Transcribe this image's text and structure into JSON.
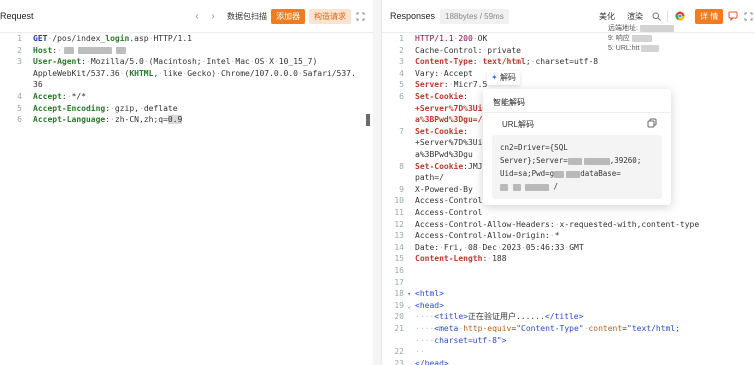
{
  "request": {
    "title": "Request",
    "nav_prev": "‹",
    "nav_next": "›",
    "btn_scan": "数据包扫描",
    "btn_add": "添加器",
    "btn_build": "构造请求",
    "lines": [
      {
        "n": "1",
        "parts": [
          [
            "kw",
            "GET"
          ],
          [
            "dots",
            "·"
          ],
          [
            "val",
            "/pos/index_"
          ],
          [
            "key",
            "login"
          ],
          [
            "val",
            ".asp"
          ],
          [
            "dots",
            "·"
          ],
          [
            "val",
            "HTTP/1.1"
          ]
        ]
      },
      {
        "n": "2",
        "parts": [
          [
            "key",
            "Host"
          ],
          [
            "val",
            ":"
          ],
          [
            "dots",
            "·"
          ]
        ]
      },
      {
        "n": "3",
        "parts": [
          [
            "key",
            "User-Agent"
          ],
          [
            "val",
            ":"
          ],
          [
            "dots",
            "·"
          ],
          [
            "val",
            "Mozilla/5.0"
          ],
          [
            "dots",
            "·"
          ],
          [
            "val",
            "(Macintosh;"
          ],
          [
            "dots",
            "·"
          ],
          [
            "val",
            "Intel"
          ],
          [
            "dots",
            "·"
          ],
          [
            "val",
            "Mac"
          ],
          [
            "dots",
            "·"
          ],
          [
            "val",
            "OS"
          ],
          [
            "dots",
            "·"
          ],
          [
            "val",
            "X"
          ],
          [
            "dots",
            "·"
          ],
          [
            "val",
            "10_15_7)"
          ]
        ]
      },
      {
        "n": "",
        "parts": [
          [
            "val",
            "AppleWebKit/537.36"
          ],
          [
            "dots",
            "·"
          ],
          [
            "val",
            "("
          ],
          [
            "key",
            "KHTML"
          ],
          [
            "val",
            ","
          ],
          [
            "dots",
            "·"
          ],
          [
            "val",
            "like"
          ],
          [
            "dots",
            "·"
          ],
          [
            "val",
            "Gecko)"
          ],
          [
            "dots",
            "·"
          ],
          [
            "val",
            "Chrome/107.0.0.0"
          ],
          [
            "dots",
            "·"
          ],
          [
            "val",
            "Safari/537."
          ]
        ]
      },
      {
        "n": "",
        "parts": [
          [
            "val",
            "36"
          ]
        ]
      },
      {
        "n": "4",
        "parts": [
          [
            "key",
            "Accept"
          ],
          [
            "val",
            ":"
          ],
          [
            "dots",
            "·"
          ],
          [
            "val",
            "*/*"
          ]
        ]
      },
      {
        "n": "5",
        "parts": [
          [
            "key",
            "Accept-Encoding"
          ],
          [
            "val",
            ":"
          ],
          [
            "dots",
            "·"
          ],
          [
            "val",
            "gzip,"
          ],
          [
            "dots",
            "·"
          ],
          [
            "val",
            "deflate"
          ]
        ]
      },
      {
        "n": "6",
        "parts": [
          [
            "key",
            "Accept-Language"
          ],
          [
            "val",
            ":"
          ],
          [
            "dots",
            "·"
          ],
          [
            "val",
            "zh-CN,zh;q="
          ],
          [
            "hl",
            "0.9"
          ]
        ]
      }
    ]
  },
  "response": {
    "title": "Responses",
    "size": "188bytes / 59ms",
    "btn_beautify": "美化",
    "btn_render": "渲染",
    "btn_detail": "详 情",
    "decode_label": "解码",
    "popup_title": "智能解码",
    "popup_sub": "URL解码",
    "popup_text_1": "cn2=Driver={SQL",
    "popup_text_2": "Server};Server=",
    "popup_text_2b": ",39260;",
    "popup_text_3": "Uid=sa;Pwd=g",
    "popup_text_3b": "dataBase=",
    "popup_text_4": "/",
    "right_info_1": "远端地址:",
    "right_info_2": "9: 响应",
    "right_info_3": "5: URL:htt",
    "lines": [
      {
        "n": "1",
        "parts": [
          [
            "str",
            "HTTP/1.1"
          ],
          [
            "dots",
            "·"
          ],
          [
            "str",
            "200"
          ],
          [
            "dots",
            "·"
          ],
          [
            "val",
            "OK"
          ]
        ]
      },
      {
        "n": "2",
        "parts": [
          [
            "val",
            "Cache-Control:"
          ],
          [
            "dots",
            "·"
          ],
          [
            "val",
            "private"
          ]
        ]
      },
      {
        "n": "3",
        "parts": [
          [
            "red-key",
            "Content-Type"
          ],
          [
            "val",
            ":"
          ],
          [
            "dots",
            "·"
          ],
          [
            "red-key",
            "text/html"
          ],
          [
            "val",
            ";"
          ],
          [
            "dots",
            "·"
          ],
          [
            "val",
            "charset=utf-8"
          ]
        ]
      },
      {
        "n": "4",
        "parts": [
          [
            "val",
            "Vary:"
          ],
          [
            "dots",
            "·"
          ],
          [
            "val",
            "Accept"
          ]
        ]
      },
      {
        "n": "5",
        "parts": [
          [
            "red-key",
            "Server"
          ],
          [
            "val",
            ":"
          ],
          [
            "dots",
            "·"
          ],
          [
            "val",
            "Micr"
          ],
          [
            "val",
            "7.5"
          ]
        ]
      },
      {
        "n": "6",
        "parts": [
          [
            "red-key",
            "Set-Cookie"
          ],
          [
            "val",
            ":"
          ]
        ]
      },
      {
        "n": "",
        "parts": [
          [
            "red-key",
            "+Server%7D%3"
          ],
          [
            "red-key",
            "Uid%3Ds"
          ]
        ]
      },
      {
        "n": "",
        "parts": [
          [
            "red-key",
            "a%3BPwd%3Dgu"
          ],
          [
            "red-key",
            "=/"
          ]
        ]
      },
      {
        "n": "7",
        "parts": [
          [
            "red-key",
            "Set-Cookie"
          ],
          [
            "val",
            ":"
          ]
        ]
      },
      {
        "n": "",
        "parts": [
          [
            "val",
            "+Server%7D%3"
          ],
          [
            "val",
            "Uid%3Ds"
          ]
        ]
      },
      {
        "n": "",
        "parts": [
          [
            "val",
            "a%3BPwd%3Dgu"
          ]
        ]
      },
      {
        "n": "8",
        "parts": [
          [
            "red-key",
            "Set-Cookie"
          ],
          [
            "val",
            ":"
          ],
          [
            "val",
            "JMJCL;"
          ]
        ]
      },
      {
        "n": "",
        "parts": [
          [
            "val",
            "path=/"
          ]
        ]
      },
      {
        "n": "9",
        "parts": [
          [
            "val",
            "X-Powered-By"
          ]
        ]
      },
      {
        "n": "10",
        "parts": [
          [
            "val",
            "Access-Control"
          ]
        ]
      },
      {
        "n": "11",
        "parts": [
          [
            "val",
            "Access-Control"
          ]
        ]
      },
      {
        "n": "12",
        "parts": [
          [
            "val",
            "Access-Control-Allow-Headers:"
          ],
          [
            "dots",
            "·"
          ],
          [
            "val",
            "x-requested-with,content-type"
          ]
        ]
      },
      {
        "n": "13",
        "parts": [
          [
            "val",
            "Access-Control-Allow-Origin:"
          ],
          [
            "dots",
            "·"
          ],
          [
            "val",
            "*"
          ]
        ]
      },
      {
        "n": "14",
        "parts": [
          [
            "val",
            "Date:"
          ],
          [
            "dots",
            "·"
          ],
          [
            "val",
            "Fri,"
          ],
          [
            "dots",
            "·"
          ],
          [
            "val",
            "08"
          ],
          [
            "dots",
            "·"
          ],
          [
            "val",
            "Dec"
          ],
          [
            "dots",
            "·"
          ],
          [
            "val",
            "2023"
          ],
          [
            "dots",
            "·"
          ],
          [
            "val",
            "05:46:33"
          ],
          [
            "dots",
            "·"
          ],
          [
            "val",
            "GMT"
          ]
        ]
      },
      {
        "n": "15",
        "parts": [
          [
            "red-key",
            "Content-Length"
          ],
          [
            "val",
            ":"
          ],
          [
            "dots",
            "·"
          ],
          [
            "val",
            "188"
          ]
        ]
      },
      {
        "n": "16",
        "parts": []
      },
      {
        "n": "17",
        "parts": []
      },
      {
        "n": "18",
        "parts": [
          [
            "tag",
            "<html>"
          ]
        ]
      },
      {
        "n": "19",
        "parts": [
          [
            "tag",
            "<head>"
          ]
        ]
      },
      {
        "n": "20",
        "parts": [
          [
            "dots",
            "····"
          ],
          [
            "tag",
            "<title>"
          ],
          [
            "val",
            "正在验证用户......"
          ],
          [
            "tag",
            "</title>"
          ]
        ]
      },
      {
        "n": "21",
        "parts": [
          [
            "dots",
            "····"
          ],
          [
            "tag",
            "<meta"
          ],
          [
            "dots",
            "·"
          ],
          [
            "attr",
            "http-equiv"
          ],
          [
            "val",
            "="
          ],
          [
            "tag",
            "\"Content-Type\""
          ],
          [
            "dots",
            "·"
          ],
          [
            "attr",
            "content"
          ],
          [
            "val",
            "="
          ],
          [
            "tag",
            "\"text/html;"
          ]
        ]
      },
      {
        "n": "",
        "parts": [
          [
            "dots",
            "····"
          ],
          [
            "tag",
            "charset=utf-8\">"
          ]
        ]
      },
      {
        "n": "22",
        "parts": [
          [
            "dots",
            "··"
          ]
        ]
      },
      {
        "n": "23",
        "parts": [
          [
            "tag",
            "</head>"
          ]
        ]
      }
    ]
  },
  "colors": {
    "accent_orange": "#f27c1d",
    "key_green": "#2a7a2a",
    "key_red": "#c0392b",
    "tag_blue": "#2a4ec9"
  }
}
